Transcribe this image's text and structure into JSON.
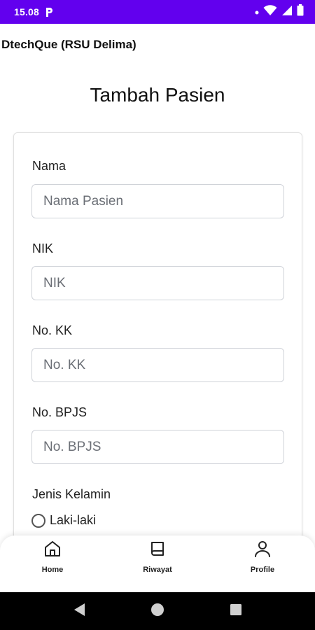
{
  "status_bar": {
    "time": "15.08",
    "icons": [
      "p-icon",
      "notification-dot-icon",
      "wifi-icon",
      "signal-icon",
      "battery-icon"
    ]
  },
  "app_bar": {
    "title": "DtechQue (RSU Delima)"
  },
  "page": {
    "title": "Tambah Pasien"
  },
  "form": {
    "fields": [
      {
        "label": "Nama",
        "placeholder": "Nama Pasien",
        "value": ""
      },
      {
        "label": "NIK",
        "placeholder": "NIK",
        "value": ""
      },
      {
        "label": "No. KK",
        "placeholder": "No. KK",
        "value": ""
      },
      {
        "label": "No. BPJS",
        "placeholder": "No. BPJS",
        "value": ""
      }
    ],
    "gender": {
      "label": "Jenis Kelamin",
      "options": [
        {
          "label": "Laki-laki",
          "selected": false
        }
      ]
    }
  },
  "bottom_nav": {
    "items": [
      {
        "label": "Home",
        "icon": "home-icon"
      },
      {
        "label": "Riwayat",
        "icon": "book-icon"
      },
      {
        "label": "Profile",
        "icon": "person-icon"
      }
    ]
  },
  "colors": {
    "status_bar": "#6200ee",
    "input_border": "#cfd2d8",
    "system_nav": "#000000"
  }
}
